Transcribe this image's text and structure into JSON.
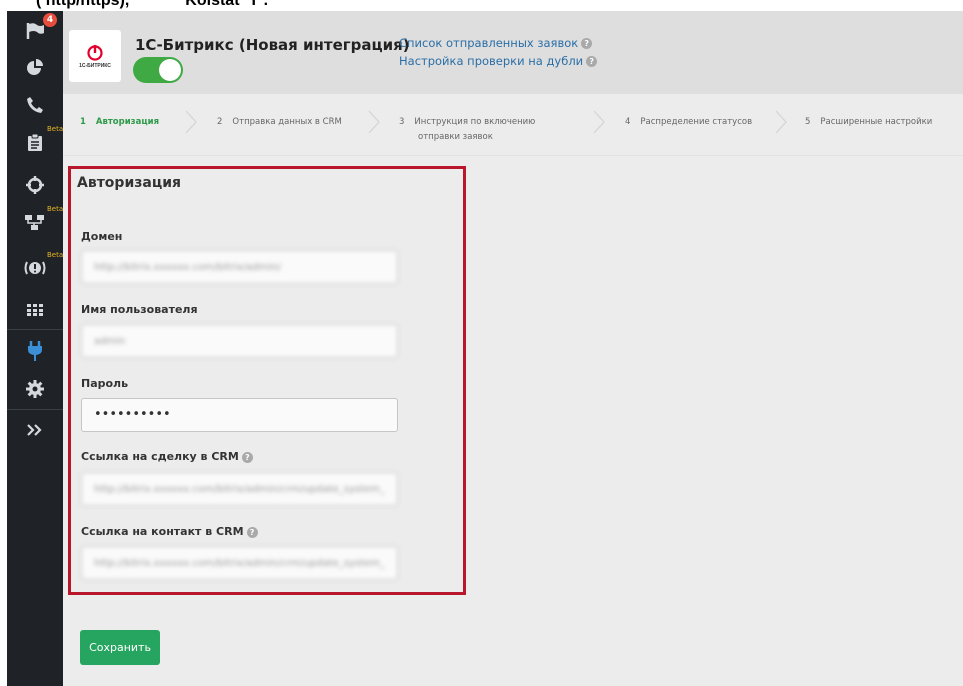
{
  "snippet": {
    "left_text": "( http/https),",
    "right_text": "Kolstat\" I\"."
  },
  "sidebar": {
    "notification_count": "4",
    "beta_label": "Beta",
    "items": [
      {
        "icon": "flag-icon"
      },
      {
        "icon": "pie-chart-icon"
      },
      {
        "icon": "phone-icon"
      },
      {
        "icon": "clipboard-icon",
        "beta": true
      },
      {
        "icon": "crosshair-icon"
      },
      {
        "icon": "hierarchy-icon",
        "beta": true
      },
      {
        "icon": "alert-icon",
        "beta": true
      },
      {
        "icon": "apps-grid-icon"
      },
      {
        "icon": "plug-icon",
        "active": true
      },
      {
        "icon": "gear-icon"
      },
      {
        "icon": "expand-icon"
      }
    ],
    "colors": {
      "bg": "#1f2327",
      "icon": "#d5d9dd",
      "active": "#3b8fd6",
      "badge": "#e74c3c",
      "beta": "#e6b422"
    }
  },
  "header": {
    "logo_text": "1С-БИТРИКС",
    "title": "1С-Битрикс (Новая интеграция)",
    "toggle_on": true,
    "link_sent_requests": "Список отправленных заявок",
    "link_duplicate_check": "Настройка проверки на дубли"
  },
  "steps": [
    {
      "num": "1",
      "label": "Авторизация",
      "active": true
    },
    {
      "num": "2",
      "label": "Отправка данных в CRM"
    },
    {
      "num": "3",
      "label": "Инструкция по включению",
      "label2": "отправки заявок"
    },
    {
      "num": "4",
      "label": "Распределение статусов"
    },
    {
      "num": "5",
      "label": "Расширенные настройки"
    }
  ],
  "form": {
    "title": "Авторизация",
    "domain_label": "Домен",
    "domain_value": "http://bitrix.xxxxxx.com/bitrix/admin/",
    "username_label": "Имя пользователя",
    "username_value": "admin",
    "password_label": "Пароль",
    "password_value": "••••••••••",
    "deal_link_label": "Ссылка на сделку в CRM",
    "deal_link_value": "http://bitrix.xxxxxx.com/bitrix/admin/crm/update_system_p",
    "contact_link_label": "Ссылка на контакт в CRM",
    "contact_link_value": "http://bitrix.xxxxxx.com/bitrix/admin/crm/update_system_p",
    "highlight_color": "#b8162b"
  },
  "actions": {
    "save_label": "Сохранить",
    "save_color": "#26a560"
  }
}
